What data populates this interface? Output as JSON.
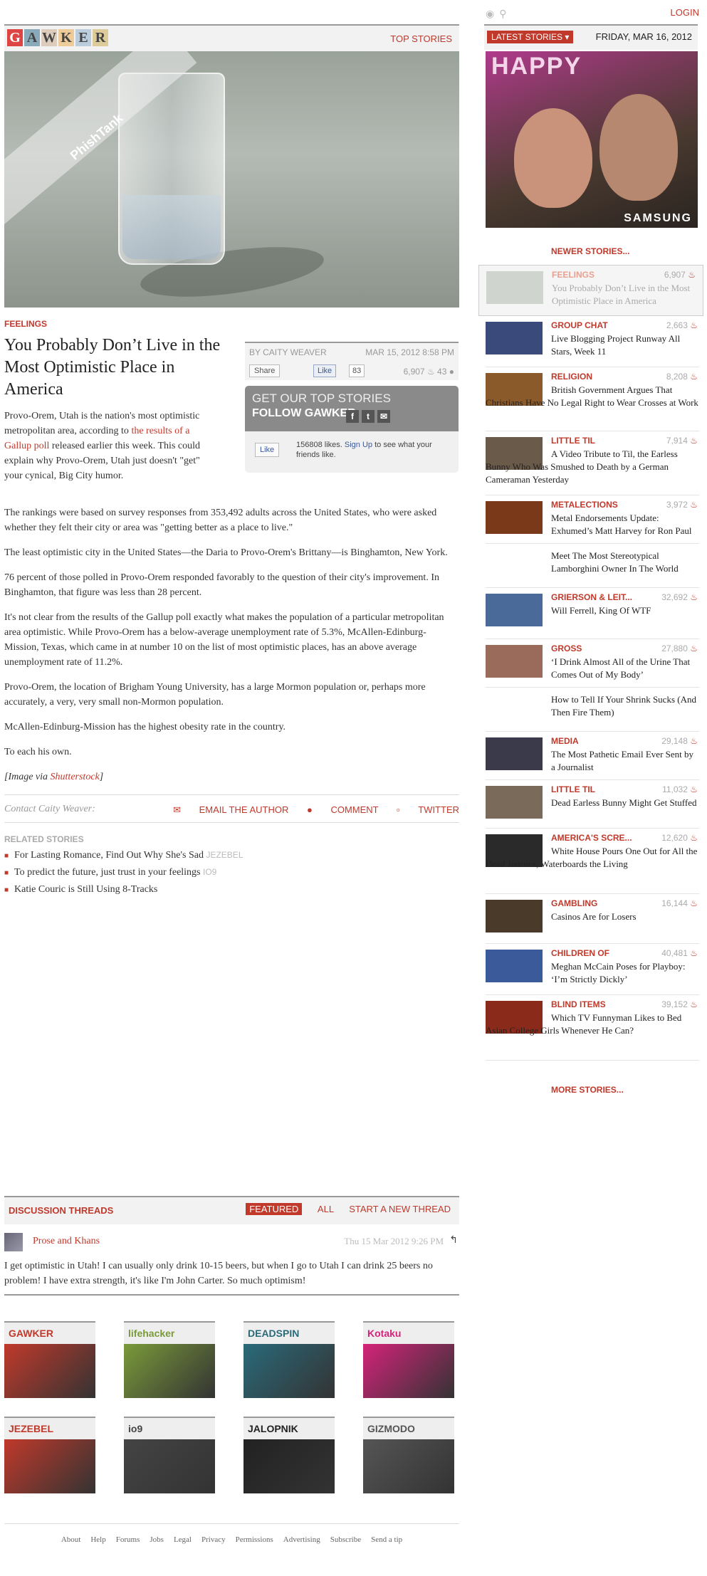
{
  "site": {
    "logo_letters": [
      "G",
      "A",
      "W",
      "K",
      "E",
      "R"
    ],
    "top_stories": "TOP STORIES",
    "login": "LOGIN"
  },
  "hero": {
    "watermark": "PhishTank"
  },
  "article": {
    "category": "FEELINGS",
    "headline": "You Probably Don’t Live in the Most Optimistic Place in America",
    "byline": "BY CAITY WEAVER",
    "date": "MAR 15, 2012 8:58 PM",
    "share": "Share",
    "like": "Like",
    "like_count": "83",
    "views": "6,907",
    "comments": "43",
    "lead_pre": "Provo-Orem, Utah is the nation's most optimistic metropolitan area, according to ",
    "lead_link": "the results of a Gallup poll",
    "lead_post": " released earlier this week. This could explain why Provo-Orem, Utah just doesn't \"get\" your cynical, Big City humor.",
    "paragraphs": [
      "The rankings were based on survey responses from 353,492 adults across the United States, who were asked whether they felt their city or area was \"getting better as a place to live.\"",
      "The least optimistic city in the United States—the Daria to Provo-Orem's Brittany—is Binghamton, New York.",
      "76 percent of those polled in Provo-Orem responded favorably to the question of their city's improvement. In Binghamton, that figure was less than 28 percent.",
      "It's not clear from the results of the Gallup poll exactly what makes the population of a particular metropolitan area optimistic. While Provo-Orem has a below-average unemployment rate of 5.3%, McAllen-Edinburg-Mission, Texas, which came in at number 10 on the list of most optimistic places, has an above average unemployment rate of 11.2%.",
      "Provo-Orem, the location of Brigham Young University, has a large Mormon population or, perhaps more accurately, a very, very small non-Mormon population.",
      "McAllen-Edinburg-Mission has the highest obesity rate in the country.",
      "To each his own."
    ],
    "image_credit_pre": "[Image via ",
    "image_credit_link": "Shutterstock",
    "image_credit_post": "]",
    "contact": "Contact Caity Weaver:",
    "email": "EMAIL THE AUTHOR",
    "comment": "COMMENT",
    "twitter": "TWITTER"
  },
  "follow": {
    "line1": "GET OUR TOP STORIES",
    "line2": "FOLLOW GAWKER",
    "fb_like": "Like",
    "fb_text_pre": "156808 likes. ",
    "fb_signup": "Sign Up",
    "fb_text_post": " to see what your friends like."
  },
  "related": {
    "heading": "RELATED STORIES",
    "items": [
      {
        "title": "For Lasting Romance, Find Out Why She's Sad",
        "src": "JEZEBEL"
      },
      {
        "title": "To predict the future, just trust in your feelings",
        "src": "IO9"
      },
      {
        "title": "Katie Couric is Still Using 8-Tracks",
        "src": ""
      }
    ]
  },
  "discussion": {
    "title": "DISCUSSION THREADS",
    "tab_featured": "FEATURED",
    "tab_all": "ALL",
    "tab_new": "START A NEW THREAD",
    "author": "Prose and Khans",
    "date": "Thu 15 Mar 2012 9:26 PM",
    "body": "I get optimistic in Utah! I can usually only drink 10-15 beers, but when I go to Utah I can drink 25 beers no problem! I have extra strength, it's like I'm John Carter. So much optimism!"
  },
  "network": [
    {
      "name": "GAWKER",
      "color": "#c0392b"
    },
    {
      "name": "lifehacker",
      "color": "#7a9a3a"
    },
    {
      "name": "DEADSPIN",
      "color": "#2a6a7a"
    },
    {
      "name": "Kotaku",
      "color": "#d4237a"
    },
    {
      "name": "JEZEBEL",
      "color": "#c0392b"
    },
    {
      "name": "io9",
      "color": "#444"
    },
    {
      "name": "JALOPNIK",
      "color": "#222"
    },
    {
      "name": "GIZMODO",
      "color": "#555"
    }
  ],
  "footer": [
    "About",
    "Help",
    "Forums",
    "Jobs",
    "Legal",
    "Privacy",
    "Permissions",
    "Advertising",
    "Subscribe",
    "Send a tip"
  ],
  "sidebar": {
    "latest": "LATEST STORIES",
    "day": "FRIDAY, MAR 16, 2012",
    "ad_text": "HAPPY",
    "ad_brand": "SAMSUNG",
    "newer": "NEWER STORIES...",
    "more": "MORE STORIES...",
    "stories": [
      {
        "cat": "FEELINGS",
        "count": "6,907",
        "title": "You Probably Don’t Live in the Most Optimistic Place in America",
        "thumb": "#cfd4cf"
      },
      {
        "cat": "GROUP CHAT",
        "count": "2,663",
        "title": "Live Blogging Project Runway All Stars, Week 11",
        "thumb": "#3a4a7a"
      },
      {
        "cat": "RELIGION",
        "count": "8,208",
        "title": "British Government Argues That Christians Have No Legal Right to Wear Crosses at Work",
        "thumb": "#8a5a2a"
      },
      {
        "cat": "LITTLE TIL",
        "count": "7,914",
        "title": "A Video Tribute to Til, the Earless Bunny Who Was Smushed to Death by a German Cameraman Yesterday",
        "thumb": "#6a5a4a"
      },
      {
        "cat": "METALECTIONS",
        "count": "3,972",
        "title": "Metal Endorsements Update: Exhumed’s Matt Harvey for Ron Paul",
        "thumb": "#7a3a1a"
      },
      {
        "cat": "",
        "count": "",
        "title": "Meet The Most Stereotypical Lamborghini Owner In The World",
        "thumb": ""
      },
      {
        "cat": "GRIERSON & LEIT...",
        "count": "32,692",
        "title": "Will Ferrell, King Of WTF",
        "thumb": "#4a6a9a"
      },
      {
        "cat": "GROSS",
        "count": "27,880",
        "title": "‘I Drink Almost All of the Urine That Comes Out of My Body’",
        "thumb": "#9a6a5a"
      },
      {
        "cat": "",
        "count": "",
        "title": "How to Tell If Your Shrink Sucks (And Then Fire Them)",
        "thumb": ""
      },
      {
        "cat": "MEDIA",
        "count": "29,148",
        "title": "The Most Pathetic Email Ever Sent by a Journalist",
        "thumb": "#3a3a4a"
      },
      {
        "cat": "LITTLE TIL",
        "count": "11,032",
        "title": "Dead Earless Bunny Might Get Stuffed",
        "thumb": "#7a6a5a"
      },
      {
        "cat": "AMERICA'S SCRE...",
        "count": "12,620",
        "title": "White House Pours One Out for All the Dead Journos, Waterboards the Living",
        "thumb": "#2a2a2a"
      },
      {
        "cat": "GAMBLING",
        "count": "16,144",
        "title": "Casinos Are for Losers",
        "thumb": "#4a3a2a"
      },
      {
        "cat": "CHILDREN OF",
        "count": "40,481",
        "title": "Meghan McCain Poses for Playboy: ‘I’m Strictly Dickly’",
        "thumb": "#3a5a9a"
      },
      {
        "cat": "BLIND ITEMS",
        "count": "39,152",
        "title": "Which TV Funnyman Likes to Bed Asian College Girls Whenever He Can?",
        "thumb": "#8a2a1a"
      }
    ]
  }
}
